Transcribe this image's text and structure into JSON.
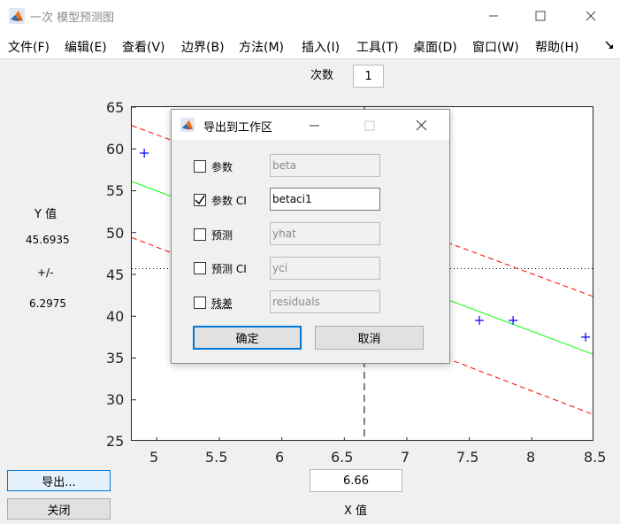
{
  "window": {
    "title": "一次 模型预测图"
  },
  "menu": [
    "文件(F)",
    "编辑(E)",
    "查看(V)",
    "边界(B)",
    "方法(M)",
    "插入(I)",
    "工具(T)",
    "桌面(D)",
    "窗口(W)",
    "帮助(H)"
  ],
  "iteration": {
    "label": "次数",
    "value": "1"
  },
  "y_panel": {
    "label": "Y 值",
    "value": "45.6935",
    "pm": "+/-",
    "interval": "6.2975"
  },
  "x_panel": {
    "label": "X 值",
    "value": "6.66"
  },
  "buttons": {
    "export": "导出...",
    "close": "关闭"
  },
  "colors": {
    "fit": "#00ff00",
    "bounds": "#ff0000",
    "points": "#0000ff",
    "accent": "#0078d7"
  },
  "chart_data": {
    "type": "scatter",
    "xlim": [
      4.8,
      8.5
    ],
    "ylim": [
      25,
      65
    ],
    "x_ticks": [
      5,
      5.5,
      6,
      6.5,
      7,
      7.5,
      8,
      8.5
    ],
    "y_ticks": [
      25,
      30,
      35,
      40,
      45,
      50,
      55,
      60,
      65
    ],
    "points": [
      [
        4.9,
        59.5
      ],
      [
        7.58,
        39.5
      ],
      [
        7.85,
        39.5
      ],
      [
        8.43,
        37.5
      ]
    ],
    "fit_line": [
      [
        4.8,
        56.1
      ],
      [
        8.5,
        35.4
      ]
    ],
    "upper_bound": [
      [
        4.8,
        62.8
      ],
      [
        8.5,
        42.3
      ]
    ],
    "lower_bound": [
      [
        4.8,
        49.4
      ],
      [
        8.5,
        28.2
      ]
    ],
    "crosshair": {
      "x": 6.66,
      "y": 45.6935
    }
  },
  "dialog": {
    "title": "导出到工作区",
    "rows": [
      {
        "label": "参数",
        "checked": false,
        "value": "beta",
        "active": false
      },
      {
        "label": "参数 CI",
        "checked": true,
        "value": "betaci1",
        "active": true
      },
      {
        "label": "预测",
        "checked": false,
        "value": "yhat",
        "active": false
      },
      {
        "label": "预测 CI",
        "checked": false,
        "value": "yci",
        "active": false
      },
      {
        "label": "残差",
        "checked": false,
        "value": "residuals",
        "active": false
      }
    ],
    "ok": "确定",
    "cancel": "取消"
  }
}
